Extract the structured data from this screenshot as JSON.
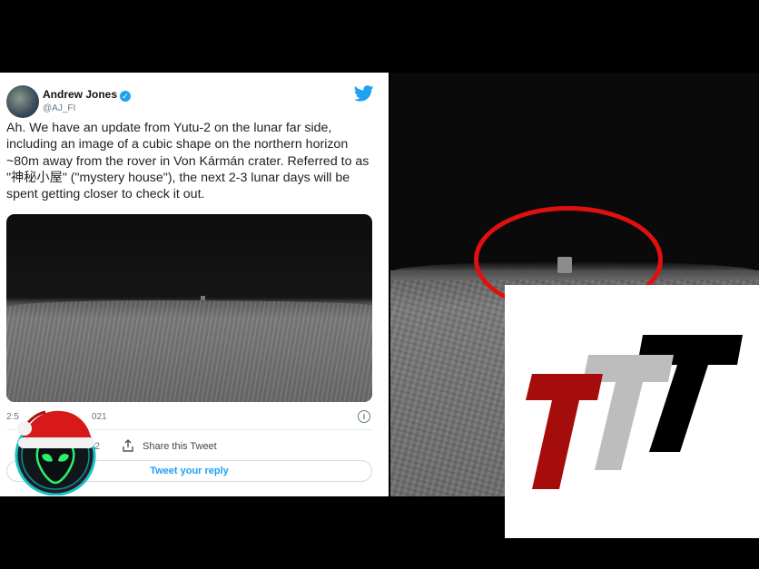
{
  "tweet": {
    "author_name": "Andrew Jones",
    "handle": "@AJ_FI",
    "text": "Ah. We have an update from Yutu-2 on the lunar far side, including an image of a cubic shape on the northern horizon ~80m away from the rover in Von Kármán crater. Referred to as \"神秘小屋\" (\"mystery house\"), the next 2-3 lunar days will be spent getting closer to check it out.",
    "timestamp_visible": "2:5",
    "timestamp_tail": "021",
    "retweet_count": "2",
    "share_label": "Share this Tweet",
    "reply_label": "Tweet your reply",
    "icons": {
      "verified": "verified-badge-icon",
      "twitter": "twitter-bird-icon",
      "info": "info-icon",
      "share": "share-icon"
    }
  },
  "colors": {
    "twitter_blue": "#1da1f2",
    "highlight_ring": "#e01010",
    "logo_red": "#a50c0c",
    "logo_gray": "#bdbdbd",
    "logo_black": "#000000"
  },
  "overlays": {
    "santa_alien": "santa-hat-alien-icon",
    "logo": "ttt-logo"
  }
}
